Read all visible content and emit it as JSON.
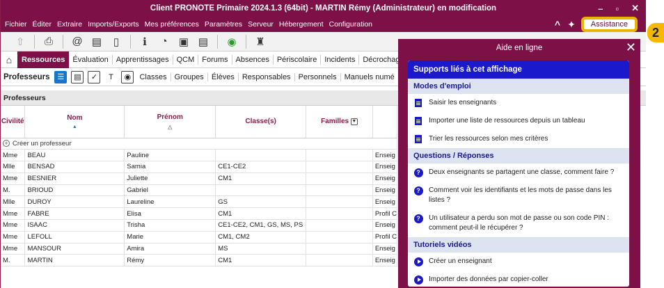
{
  "window": {
    "title": "Client PRONOTE Primaire 2024.1.3 (64bit) - MARTIN Rémy (Administrateur) en modification",
    "minimize": "–",
    "maximize": "▫",
    "close": "✕"
  },
  "menu": [
    "Fichier",
    "Éditer",
    "Extraire",
    "Imports/Exports",
    "Mes préférences",
    "Paramètres",
    "Serveur",
    "Hébergement",
    "Configuration"
  ],
  "assist_button": "Assistance",
  "badge": "2",
  "main_tabs": [
    "Ressources",
    "Évaluation",
    "Apprentissages",
    "QCM",
    "Forums",
    "Absences",
    "Périscolaire",
    "Incidents",
    "Décrochage"
  ],
  "sub": {
    "title": "Professeurs",
    "links": [
      "Classes",
      "Groupes",
      "Élèves",
      "Responsables",
      "Personnels",
      "Manuels numé"
    ]
  },
  "section_title": "Professeurs",
  "table": {
    "headers": [
      "Civilité",
      "Nom",
      "Prénom",
      "Classe(s)",
      "Familles",
      ""
    ],
    "create_label": "Créer un professeur",
    "rows": [
      [
        "Mme",
        "BEAU",
        "Pauline",
        "",
        "",
        "Enseig"
      ],
      [
        "Mlle",
        "BENSAD",
        "Samia",
        "CE1-CE2",
        "",
        "Enseig"
      ],
      [
        "Mme",
        "BESNIER",
        "Juliette",
        "CM1",
        "",
        "Enseig"
      ],
      [
        "M.",
        "BRIOUD",
        "Gabriel",
        "",
        "",
        "Enseig"
      ],
      [
        "Mlle",
        "DUROY",
        "Laureline",
        "GS",
        "",
        "Enseig"
      ],
      [
        "Mme",
        "FABRE",
        "Elisa",
        "CM1",
        "",
        "Profil C"
      ],
      [
        "Mme",
        "ISAAC",
        "Trisha",
        "CE1-CE2, CM1, GS, MS, PS",
        "",
        "Enseig"
      ],
      [
        "Mme",
        "LEFOLL",
        "Marie",
        "CM1, CM2",
        "",
        "Profil C"
      ],
      [
        "Mme",
        "MANSOUR",
        "Amira",
        "MS",
        "",
        "Enseig"
      ],
      [
        "M.",
        "MARTIN",
        "Rémy",
        "CM1",
        "",
        "Enseig"
      ]
    ]
  },
  "help": {
    "title": "Aide en ligne",
    "banner": "Supports liés à cet affichage",
    "sections": [
      {
        "title": "Modes d'emploi",
        "kind": "doc",
        "items": [
          "Saisir les enseignants",
          "Importer une liste de ressources depuis un tableau",
          "Trier les ressources selon mes critères"
        ]
      },
      {
        "title": "Questions / Réponses",
        "kind": "question",
        "items": [
          "Deux enseignants se partagent une classe, comment faire ?",
          "Comment voir les identifiants et les mots de passe dans les listes ?",
          "Un utilisateur a perdu son mot de passe ou son code PIN : comment peut-il le récupérer ?"
        ]
      },
      {
        "title": "Tutoriels vidéos",
        "kind": "video",
        "items": [
          "Créer un enseignant",
          "Importer des données par copier-coller"
        ]
      }
    ]
  },
  "colors": {
    "brand": "#7d1047",
    "help_accent": "#1a1acc",
    "badge": "#f5b800"
  }
}
